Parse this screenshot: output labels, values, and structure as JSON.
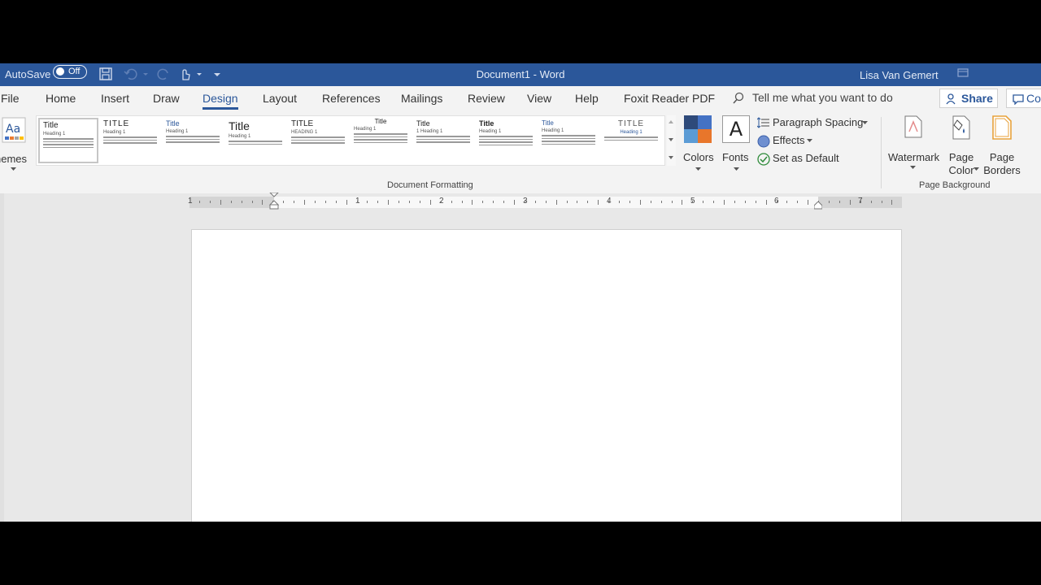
{
  "titlebar": {
    "autosave_label": "AutoSave",
    "autosave_state": "Off",
    "document_title": "Document1  -  Word",
    "user_name": "Lisa Van Gemert"
  },
  "tabs": [
    {
      "label": "File"
    },
    {
      "label": "Home"
    },
    {
      "label": "Insert"
    },
    {
      "label": "Draw"
    },
    {
      "label": "Design",
      "active": true
    },
    {
      "label": "Layout"
    },
    {
      "label": "References"
    },
    {
      "label": "Mailings"
    },
    {
      "label": "Review"
    },
    {
      "label": "View"
    },
    {
      "label": "Help"
    },
    {
      "label": "Foxit Reader PDF"
    }
  ],
  "tellme": "Tell me what you want to do",
  "share_label": "Share",
  "comments_label": "Co",
  "ribbon": {
    "themes_label": "hemes",
    "style_titles": [
      "Title",
      "TITLE",
      "Title",
      "Title",
      "TITLE",
      "Title",
      "Title",
      "Title",
      "Title",
      "TITLE"
    ],
    "style_headings": [
      "Heading 1",
      "Heading 1",
      "Heading 1",
      "Heading 1",
      "HEADING 1",
      "Heading 1",
      "1  Heading 1",
      "Heading 1",
      "Heading 1",
      "Heading 1"
    ],
    "colors_label": "Colors",
    "fonts_label": "Fonts",
    "fonts_glyph": "A",
    "paragraph_spacing_label": "Paragraph Spacing",
    "effects_label": "Effects",
    "set_default_label": "Set as Default",
    "watermark_label": "Watermark",
    "page_color_label_1": "Page",
    "page_color_label_2": "Color",
    "page_borders_label_1": "Page",
    "page_borders_label_2": "Borders",
    "group_document_formatting": "Document Formatting",
    "group_page_background": "Page Background"
  },
  "ruler": {
    "numbers": [
      "1",
      "1",
      "2",
      "3",
      "4",
      "5",
      "6",
      "7"
    ]
  },
  "colors": {
    "accent": "#2b579a",
    "swatch_1": "#2e4a7a",
    "swatch_2": "#e8762b",
    "swatch_3": "#4472c4",
    "swatch_4": "#5b9bd5"
  }
}
